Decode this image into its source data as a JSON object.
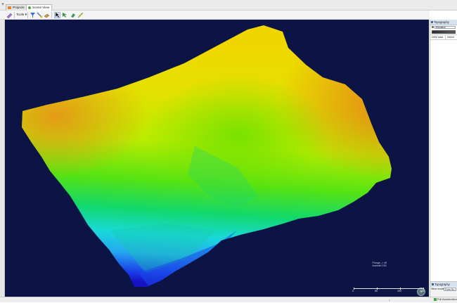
{
  "tabs": [
    {
      "label": "Projects",
      "icon": "folder-icon",
      "color": "#d98a2b"
    },
    {
      "label": "Scene View",
      "icon": "globe-icon",
      "color": "#4aa54a"
    }
  ],
  "toolbar": {
    "tools_label": "Tools",
    "icons": [
      "ruler-icon",
      "tools-menu-icon",
      "filter-icon",
      "pick-icon",
      "select-arrow-icon",
      "pointer-green-icon",
      "paint-icon",
      "pencil-icon"
    ]
  },
  "scene": {
    "readout_line1": "Plunge -> 45",
    "readout_line2": "Azimuth 315",
    "compass_label": "N",
    "scale_labels": [
      "0",
      "50",
      "100",
      "150"
    ],
    "colors": {
      "background": "#0c1446",
      "high": "#e07a1d",
      "mid": "#9be000",
      "low": "#1b1fd6"
    }
  },
  "right_panel": {
    "header": "Topography",
    "elevation_label": "Elevation",
    "table_col1": "DEM data",
    "table_col2": "Select",
    "bottom_header": "Topography",
    "slice_mode_label": "Slice mode:",
    "slice_mode_value": "From Sc..."
  },
  "status": {
    "right_text": "Full Acceleration"
  }
}
